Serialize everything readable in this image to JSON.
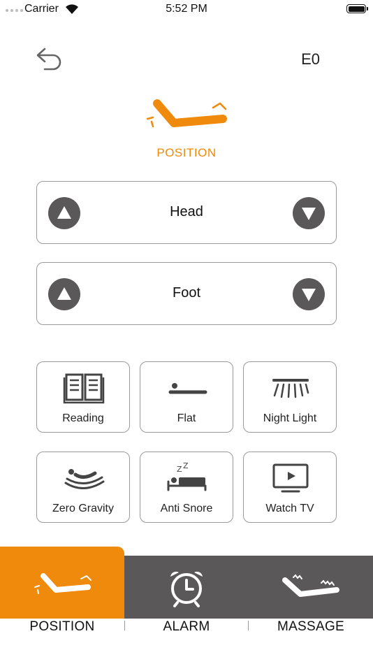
{
  "status_bar": {
    "carrier": "Carrier",
    "time": "5:52 PM"
  },
  "header": {
    "back_icon": "back-arrow-icon",
    "code": "E0"
  },
  "hero": {
    "icon": "bed-position-icon",
    "label": "POSITION"
  },
  "controls": [
    {
      "label": "Head",
      "up_icon": "triangle-up-icon",
      "down_icon": "triangle-down-icon"
    },
    {
      "label": "Foot",
      "up_icon": "triangle-up-icon",
      "down_icon": "triangle-down-icon"
    }
  ],
  "presets": [
    {
      "label": "Reading",
      "icon": "book-icon"
    },
    {
      "label": "Flat",
      "icon": "flat-bed-icon"
    },
    {
      "label": "Night Light",
      "icon": "light-icon"
    },
    {
      "label": "Zero Gravity",
      "icon": "zero-gravity-icon"
    },
    {
      "label": "Anti Snore",
      "icon": "snore-icon"
    },
    {
      "label": "Watch TV",
      "icon": "tv-icon"
    }
  ],
  "tabs": [
    {
      "label": "POSITION",
      "icon": "bed-position-icon",
      "active": true
    },
    {
      "label": "ALARM",
      "icon": "alarm-clock-icon",
      "active": false
    },
    {
      "label": "MASSAGE",
      "icon": "massage-bed-icon",
      "active": false
    }
  ],
  "colors": {
    "accent": "#ef8a0c",
    "dark_gray": "#5a5858",
    "border": "#9a9a9a"
  }
}
